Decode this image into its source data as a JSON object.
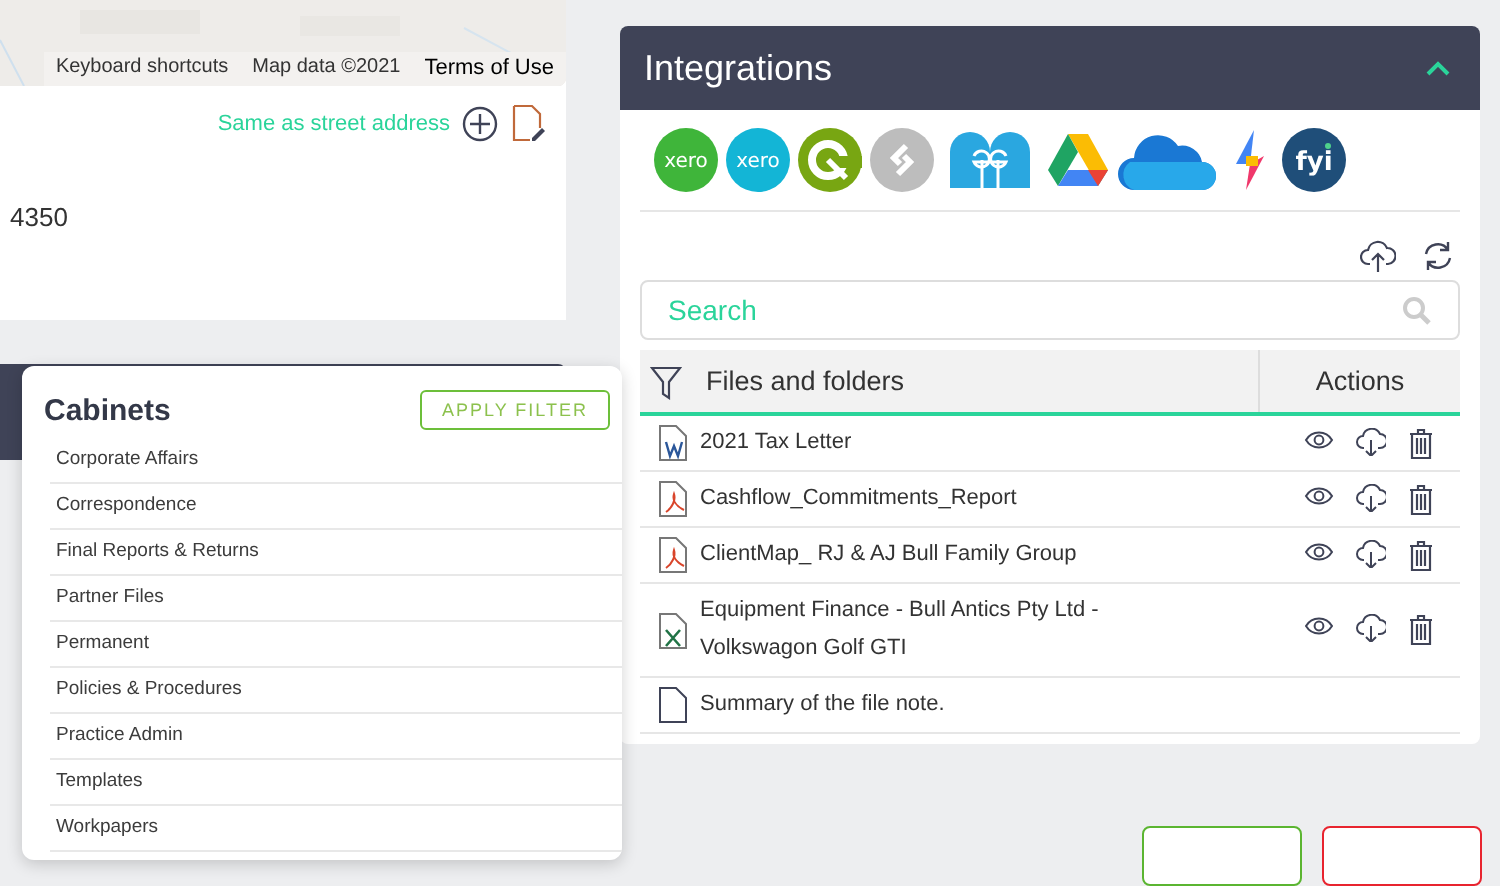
{
  "map": {
    "attribution": [
      "Keyboard shortcuts",
      "Map data ©2021",
      "Terms of Use"
    ]
  },
  "address": {
    "same_as_link": "Same as street address",
    "postcode": "4350"
  },
  "cabinets": {
    "title": "Cabinets",
    "apply_button": "APPLY FILTER",
    "items": [
      "Corporate Affairs",
      "Correspondence",
      "Final Reports & Returns",
      "Partner Files",
      "Permanent",
      "Policies & Procedures",
      "Practice Admin",
      "Templates",
      "Workpapers"
    ]
  },
  "integrations": {
    "title": "Integrations",
    "expanded": true,
    "apps": [
      {
        "kind": "xero",
        "label": "xero",
        "color": "#3fb53a"
      },
      {
        "kind": "xero",
        "label": "xero",
        "color": "#13b5d6"
      },
      {
        "kind": "ring",
        "color": "#78a612"
      },
      {
        "kind": "link",
        "color": "#bdbdbd"
      },
      {
        "kind": "heads",
        "color": "#2aa7e0"
      },
      {
        "kind": "drive",
        "color": "#1fa463"
      },
      {
        "kind": "cloud",
        "color": "#1a78d4"
      },
      {
        "kind": "bolt",
        "color": "#f0386b"
      },
      {
        "kind": "fyi",
        "label": "fyi",
        "color": "#1f4e79"
      }
    ],
    "search": {
      "placeholder": "Search"
    },
    "columns": [
      "Files and folders",
      "Actions"
    ],
    "files": [
      {
        "name": "2021 Tax Letter",
        "kind": "word",
        "actions": true
      },
      {
        "name": "Cashflow_Commitments_Report",
        "kind": "pdf",
        "actions": true
      },
      {
        "name": "ClientMap_ RJ & AJ Bull Family Group",
        "kind": "pdf",
        "actions": true
      },
      {
        "name": "Equipment Finance - Bull Antics Pty Ltd - Volkswagon Golf GTI",
        "kind": "excel",
        "actions": true
      },
      {
        "name": "Summary of the file note.",
        "kind": "file",
        "actions": false
      }
    ]
  },
  "bottom_buttons": [
    {
      "color": "#5bb531"
    },
    {
      "color": "#e8242f"
    }
  ]
}
